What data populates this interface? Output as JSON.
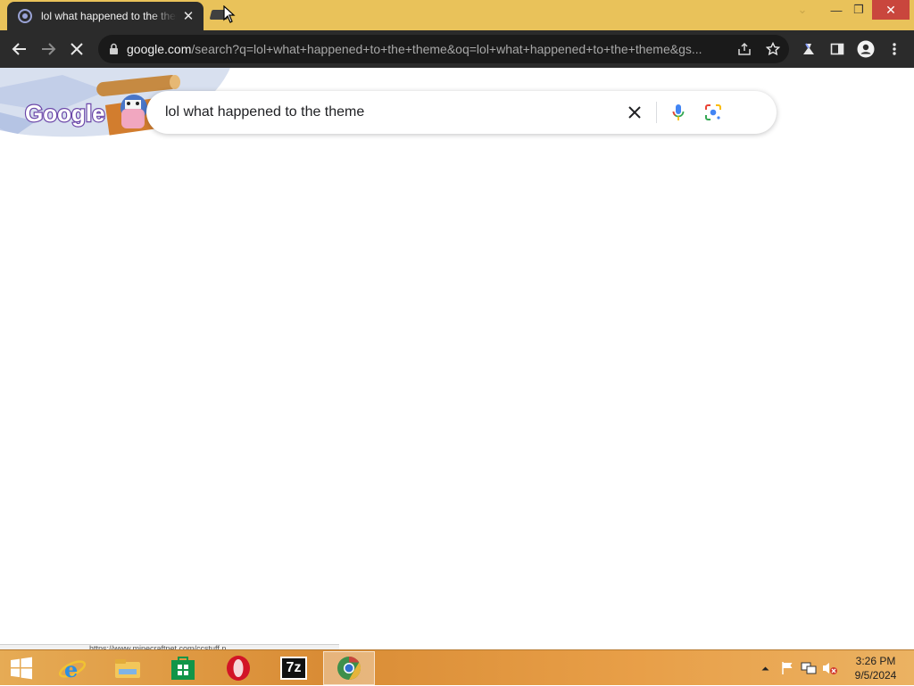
{
  "browser": {
    "tab": {
      "title": "lol what happened to the theme",
      "close_glyph": "✕",
      "favicon": "loading-spinner-icon"
    },
    "window_controls": {
      "search_tabs": "⌄",
      "minimize": "—",
      "restore": "❐",
      "close": "✕"
    },
    "toolbar": {
      "url_host": "google.com",
      "url_path": "/search?q=lol+what+happened+to+the+theme&oq=lol+what+happened+to+the+theme&gs...",
      "icons": [
        "back-icon",
        "forward-icon",
        "stop-loading-icon",
        "lock-icon",
        "share-icon",
        "bookmark-star-icon",
        "extensions-icon",
        "side-panel-icon",
        "profile-icon",
        "menu-icon"
      ]
    }
  },
  "google": {
    "search_query": "lol what happened to the theme",
    "doodle_text": "Google",
    "icons": [
      "clear-icon",
      "voice-search-icon",
      "lens-icon"
    ]
  },
  "status_bar": {
    "text": "https://www.minecraftnet.com/ccstuff.n..."
  },
  "taskbar": {
    "apps": [
      "windows-start",
      "internet-explorer",
      "file-explorer",
      "windows-store",
      "opera",
      "7-zip",
      "chrome"
    ],
    "zip_label": "7z",
    "clock": {
      "time": "3:26 PM",
      "date": "9/5/2024"
    },
    "accent": "#d98c35"
  },
  "colors": {
    "titlebar": "#e9c25a",
    "toolbar": "#2b2b2b",
    "close_button": "#c9463d"
  }
}
